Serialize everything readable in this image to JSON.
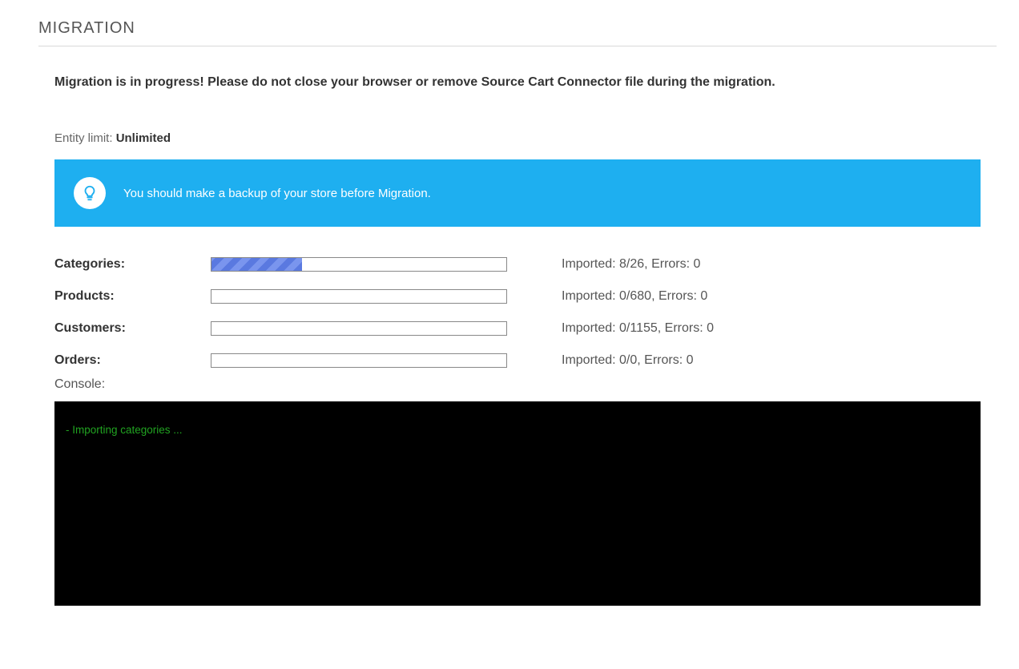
{
  "page_title": "MIGRATION",
  "warning_text": "Migration is in progress! Please do not close your browser or remove Source Cart Connector file during the migration.",
  "entity_limit": {
    "label": "Entity limit:",
    "value": "Unlimited"
  },
  "notice": {
    "icon": "lightbulb-icon",
    "text": "You should make a backup of your store before Migration."
  },
  "progress_rows": [
    {
      "label": "Categories:",
      "imported": 8,
      "total": 26,
      "errors": 0,
      "status_text": "Imported: 8/26, Errors: 0",
      "percent": 30.8
    },
    {
      "label": "Products:",
      "imported": 0,
      "total": 680,
      "errors": 0,
      "status_text": "Imported: 0/680, Errors: 0",
      "percent": 0
    },
    {
      "label": "Customers:",
      "imported": 0,
      "total": 1155,
      "errors": 0,
      "status_text": "Imported: 0/1155, Errors: 0",
      "percent": 0
    },
    {
      "label": "Orders:",
      "imported": 0,
      "total": 0,
      "errors": 0,
      "status_text": "Imported: 0/0, Errors: 0",
      "percent": 0
    }
  ],
  "console": {
    "label": "Console:",
    "lines": [
      "- Importing categories ..."
    ]
  },
  "colors": {
    "accent": "#1eaff0",
    "progress_bar": "#5a79e0",
    "console_bg": "#000000",
    "console_text": "#21a321"
  }
}
